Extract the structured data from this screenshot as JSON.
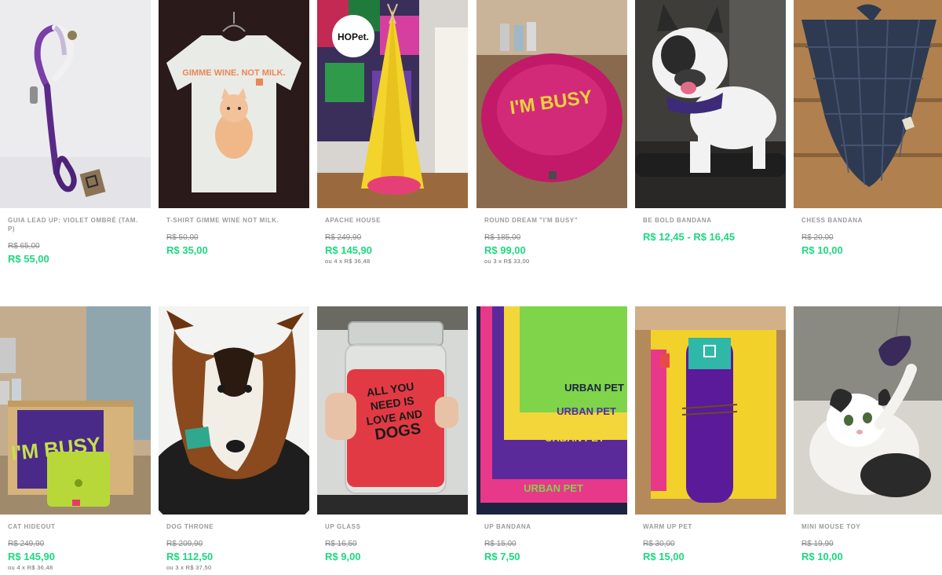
{
  "products": [
    {
      "name": "GUIA LEAD UP: VIOLET OMBRÉ (TAM. P)",
      "old_price": "R$ 65,00",
      "price": "R$ 55,00",
      "image": "purple-rope-leash"
    },
    {
      "name": "T-SHIRT GIMME WINE NOT MILK.",
      "old_price": "R$ 50,00",
      "price": "R$ 35,00",
      "image": "white-tshirt-cat-print",
      "print_text": "GIMME WINE. NOT MILK."
    },
    {
      "name": "APACHE HOUSE",
      "old_price": "R$ 249,90",
      "price": "R$ 145,90",
      "installments": "ou 4 x R$ 36,48",
      "image": "yellow-teepee-tent",
      "logo_text": "HOPet."
    },
    {
      "name": "ROUND DREAM \"I'M BUSY\"",
      "old_price": "R$ 185,00",
      "price": "R$ 99,00",
      "installments": "ou 3 x R$ 33,00",
      "image": "pink-round-pet-bed",
      "print_text": "I'M BUSY"
    },
    {
      "name": "BE BOLD BANDANA",
      "price": "R$ 12,45 - R$ 16,45",
      "image": "french-bulldog-bandana"
    },
    {
      "name": "CHESS BANDANA",
      "old_price": "R$ 20,00",
      "price": "R$ 10,00",
      "image": "plaid-bandana"
    },
    {
      "name": "CAT HIDEOUT",
      "old_price": "R$ 249,90",
      "price": "R$ 145,90",
      "installments": "ou 4 x R$ 36,48",
      "image": "wooden-cat-bed",
      "print_text": "I'M BUSY"
    },
    {
      "name": "DOG THRONE",
      "old_price": "R$ 209,90",
      "price": "R$ 112,50",
      "installments": "ou 3 x R$ 37,50",
      "image": "sheltie-dog-cushion"
    },
    {
      "name": "UP GLASS",
      "old_price": "R$ 16,50",
      "price": "R$ 9,00",
      "image": "glass-jar-red-drink",
      "print_text": "ALL YOU NEED IS LOVE AND DOGS"
    },
    {
      "name": "UP BANDANA",
      "old_price": "R$ 15,00",
      "price": "R$ 7,50",
      "image": "stacked-bandanas",
      "print_text": "URBAN PET"
    },
    {
      "name": "WARM UP PET",
      "old_price": "R$ 30,00",
      "price": "R$ 15,00",
      "image": "rolled-blanket"
    },
    {
      "name": "MINI MOUSE TOY",
      "old_price": "R$ 19,90",
      "price": "R$ 10,00",
      "image": "cat-playing-toy"
    }
  ],
  "colors": {
    "price": "#1dd880",
    "name": "#9a9a9a",
    "old_price": "#8a8a8a",
    "background": "#ffffff"
  }
}
